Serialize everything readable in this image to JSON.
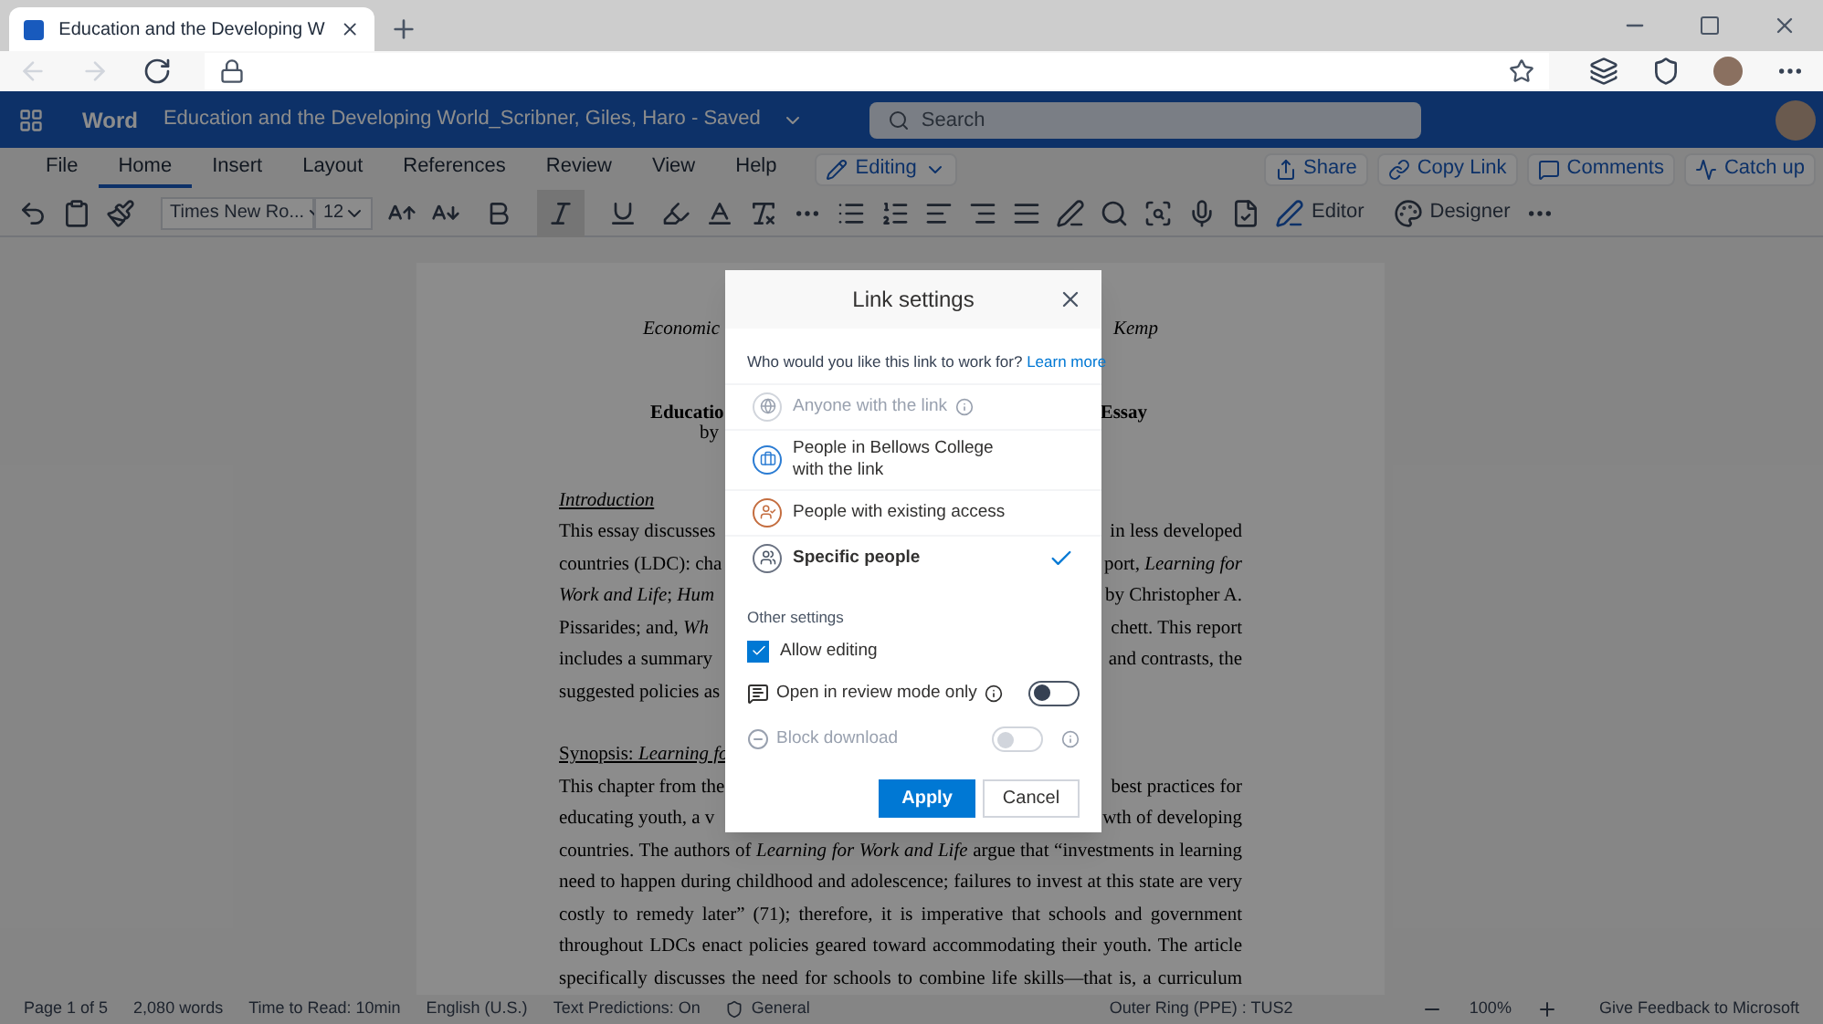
{
  "browser": {
    "tab_title": "Education and the Developing W"
  },
  "word": {
    "app_name": "Word",
    "doc_title": "Education and the Developing World_Scribner, Giles, Haro",
    "save_state": "- Saved",
    "search": {
      "placeholder": "Search"
    }
  },
  "ribbon_tabs": [
    {
      "label": "File",
      "selected": false
    },
    {
      "label": "Home",
      "selected": true
    },
    {
      "label": "Insert",
      "selected": false
    },
    {
      "label": "Layout",
      "selected": false
    },
    {
      "label": "References",
      "selected": false
    },
    {
      "label": "Review",
      "selected": false
    },
    {
      "label": "View",
      "selected": false
    },
    {
      "label": "Help",
      "selected": false
    }
  ],
  "mode": "Editing",
  "actions": [
    {
      "kind": "share",
      "label": "Share"
    },
    {
      "kind": "link",
      "label": "Copy Link"
    },
    {
      "kind": "comments",
      "label": "Comments"
    },
    {
      "kind": "catchup",
      "label": "Catch up"
    }
  ],
  "toolbar": {
    "font": "Times New Ro...",
    "size": "12",
    "format_buttons": [
      {
        "kind": "bold",
        "selected": false
      },
      {
        "kind": "italic",
        "selected": true
      },
      {
        "kind": "underline",
        "selected": false
      }
    ],
    "editor": "Editor",
    "designer": "Designer"
  },
  "document": {
    "lines": [
      {
        "kind": "heading",
        "left": "*Economic*",
        "right": "*Kemp*"
      },
      {
        "kind": "title",
        "left": "Educatio",
        "right": "Essay"
      },
      {
        "kind": "byline",
        "left": "by"
      },
      {
        "kind": "section",
        "left": "*Introduction*"
      },
      {
        "kind": "split",
        "left": "This essay discusses",
        "right": "in less developed"
      },
      {
        "kind": "split",
        "left": "countries (LDC): cha",
        "right": "port, *Learning for*"
      },
      {
        "kind": "split",
        "left": "*Work and Life*; *Hum*",
        "right": "by Christopher A."
      },
      {
        "kind": "split",
        "left": "Pissarides; and, *Wh*",
        "right": "chett. This report"
      },
      {
        "kind": "split",
        "left": "includes a summary",
        "right": "and contrasts, the"
      },
      {
        "kind": "split",
        "left": "suggested policies as"
      },
      {
        "kind": "section",
        "left": "Synopsis: *Learning fo*"
      },
      {
        "kind": "split",
        "left": "This chapter from the",
        "right": "best practices for"
      },
      {
        "kind": "split",
        "left": "educating youth, a v",
        "right": "wth of developing"
      },
      {
        "kind": "full",
        "left": "countries. The authors of *Learning for Work and Life* argue that “investments in learning"
      },
      {
        "kind": "full",
        "left": "need to happen during childhood and adolescence; failures to invest at this state are very"
      },
      {
        "kind": "full",
        "left": "costly to remedy later” (71); therefore, it is imperative that schools and government"
      },
      {
        "kind": "full",
        "left": "throughout LDCs enact policies geared toward accommodating their youth. The article"
      },
      {
        "kind": "full",
        "left": "specifically discusses the need for schools to combine life skills—that is, a curriculum"
      }
    ]
  },
  "dialog": {
    "title": "Link settings",
    "prompt": "Who would you like this link to work for?",
    "learn_more": "Learn more",
    "options": [
      {
        "kind": "anyone",
        "label": "Anyone with the link",
        "disabled": true,
        "selected": false
      },
      {
        "kind": "organization",
        "label": "People in Bellows College with the link",
        "disabled": false,
        "selected": false
      },
      {
        "kind": "existing",
        "label": "People with existing access",
        "disabled": false,
        "selected": false
      },
      {
        "kind": "specific",
        "label": "Specific people",
        "disabled": false,
        "selected": true
      }
    ],
    "other_settings_label": "Other settings",
    "allow_editing": {
      "label": "Allow editing",
      "checked": true
    },
    "review_mode": {
      "label": "Open in review mode only",
      "on": false,
      "disabled": false
    },
    "block_download": {
      "label": "Block download",
      "on": false,
      "disabled": true
    },
    "buttons": [
      {
        "kind": "primary",
        "label": "Apply"
      },
      {
        "kind": "secondary",
        "label": "Cancel"
      }
    ]
  },
  "status_bar": {
    "left": [
      "Page 1 of 5",
      "2,080 words",
      "Time to Read: 10min",
      "English (U.S.)",
      "Text Predictions: On"
    ],
    "label": "General",
    "center": "Outer Ring (PPE) : TUS2",
    "zoom": "100%",
    "feedback": "Give Feedback to Microsoft"
  }
}
